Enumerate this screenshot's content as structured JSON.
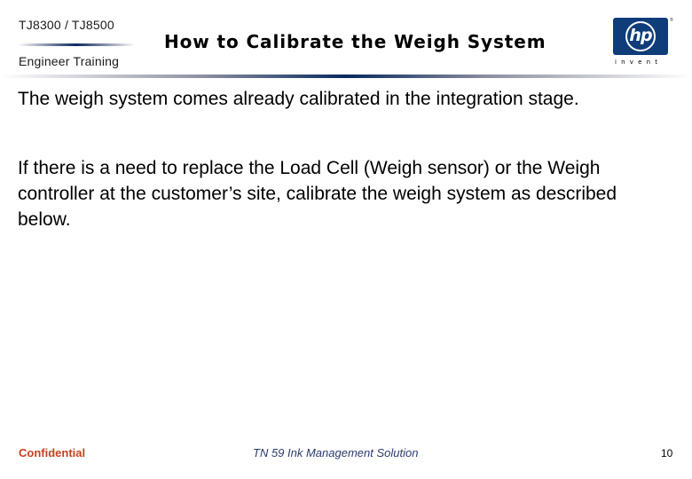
{
  "header": {
    "product_line": "TJ8300 / TJ8500",
    "course": "Engineer  Training",
    "title": "How to Calibrate the Weigh System",
    "logo": {
      "brand": "hp",
      "trademark": "®",
      "tagline": "invent",
      "brand_color": "#0f3d7a"
    }
  },
  "body": {
    "paragraphs": [
      "The weigh system comes already calibrated in the integration stage.",
      "If there is a need to replace the Load Cell (Weigh sensor) or the Weigh controller at the customer’s site, calibrate the weigh system as described below."
    ]
  },
  "footer": {
    "classification": "Confidential",
    "classification_color": "#c8411e",
    "document": "TN 59 Ink Management Solution",
    "document_color": "#2b3a6b",
    "page_number": "10"
  }
}
